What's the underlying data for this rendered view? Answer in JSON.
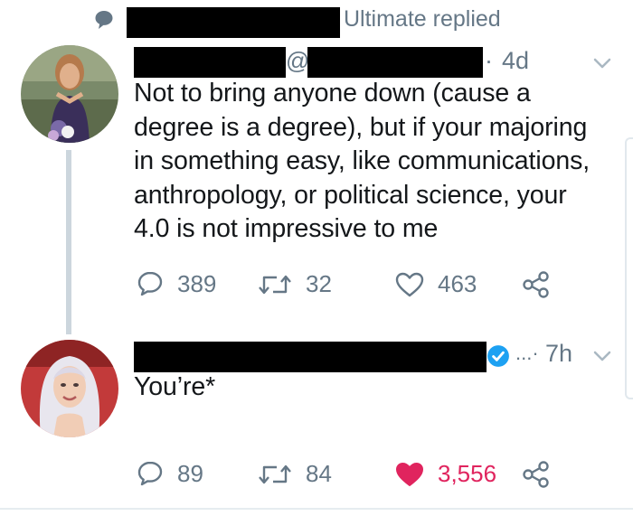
{
  "context": {
    "icon": "speech-bubble-icon",
    "text": "Ultimate replied"
  },
  "tweet1": {
    "handle_prefix": "@",
    "time": "4d",
    "time_separator": "·",
    "lines": [
      "Not to bring anyone down (cause a",
      "degree is a degree), but if your majoring",
      "in something easy, like communications,",
      "anthropology,  or political science, your",
      "4.0 is not impressive to me"
    ],
    "actions": {
      "replies": "389",
      "retweets": "32",
      "likes": "463",
      "liked": false
    }
  },
  "tweet2": {
    "verified": true,
    "time_prefix": "...·",
    "time": "7h",
    "text": "You’re*",
    "actions": {
      "replies": "89",
      "retweets": "84",
      "likes": "3,556",
      "liked": true
    }
  },
  "colors": {
    "muted": "#657786",
    "text": "#14171a",
    "like": "#e0245e",
    "verified": "#1da1f2",
    "thread_line": "#ccd6dd"
  }
}
